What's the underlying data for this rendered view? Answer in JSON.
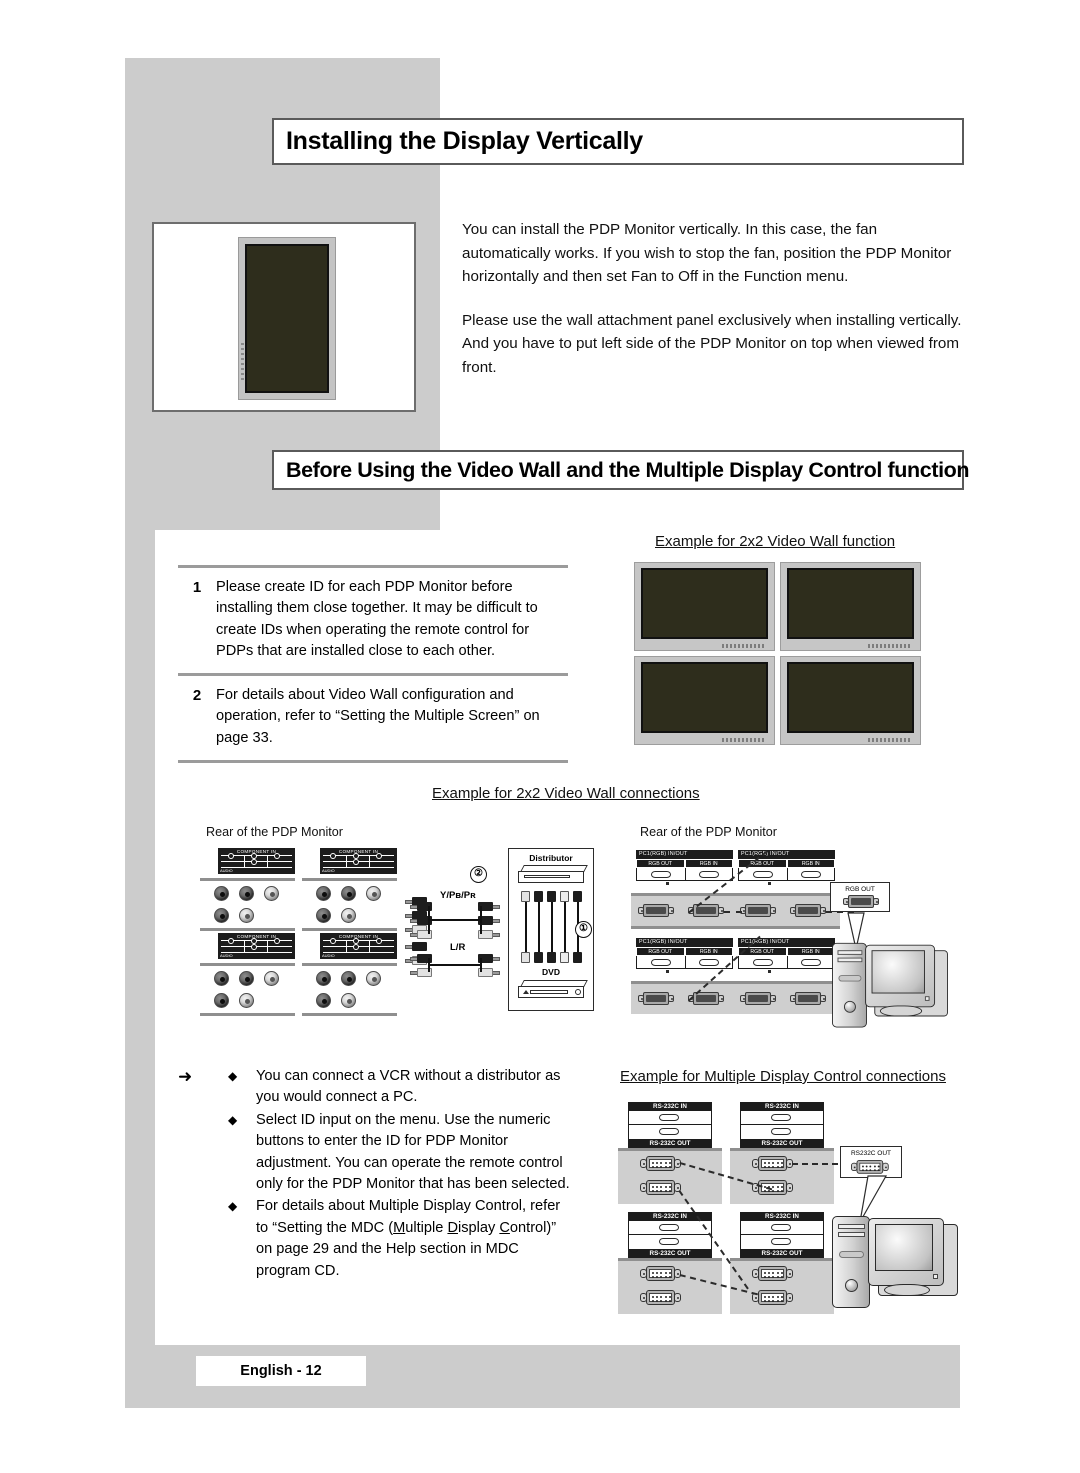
{
  "page": {
    "footer_label": "English - 12"
  },
  "headings": {
    "banner1": "Installing the Display Vertically",
    "banner2": "Before Using the Video Wall and the Multiple Display Control function"
  },
  "intro": {
    "paragraph1": "You can install the PDP Monitor vertically. In this case, the fan automatically works. If you wish to stop the fan, position the PDP Monitor horizontally and then set  Fan  to  Off  in the  Function    menu.",
    "paragraph2": "Please use the wall attachment panel exclusively when installing vertically. And you have to put left side of the PDP Monitor on top when viewed from front."
  },
  "numbered_list": [
    {
      "number": "1",
      "text": "Please create ID for each PDP Monitor before installing them close together. It may be difficult to create IDs when operating the remote control for PDPs that are installed close to each other."
    },
    {
      "number": "2",
      "text": "For details about Video Wall configuration and operation, refer to “Setting the Multiple Screen” on page 33."
    }
  ],
  "bullets": {
    "arrow_glyph": "➜",
    "bullet_glyph": "◆",
    "items": [
      {
        "text": "You can connect a VCR without a distributor as you would connect a PC."
      },
      {
        "text": "Select ID input on the menu. Use the numeric buttons to enter the ID for PDP Monitor adjustment. You can operate the remote control only for the PDP Monitor that has been selected."
      },
      {
        "text_before": "For details about Multiple Display Control, refer to “Setting the MDC (",
        "u1": "M",
        "t1": "ultiple ",
        "u2": "D",
        "t2": "isplay ",
        "u3": "C",
        "t3": "ontrol)” on page 29 and the Help section in MDC program CD."
      }
    ]
  },
  "sections": {
    "video_wall_function_title": "Example for 2x2 Video Wall function",
    "video_wall_connections_title": "Example for 2x2 Video Wall connections",
    "mdc_connections_title": "Example for Multiple Display Control connections"
  },
  "captions": {
    "rear_left": "Rear of the PDP Monitor",
    "rear_right": "Rear of the PDP Monitor"
  },
  "connection_labels": {
    "component_in": "COMPONENT IN",
    "audio": "AUDIO",
    "ypbpr": "Y/Pʙ/Pʀ",
    "lr": "L/R",
    "distributor": "Distributor",
    "dvd": "DVD",
    "marker1": "①",
    "marker2": "②",
    "pc1_rgb": "PC1(RGB) IN/OUT",
    "rgb_out": "RGB OUT",
    "rgb_in": "RGB IN",
    "callout_rgb_out": "RGB OUT",
    "rs232c_in": "RS-232C IN",
    "rs232c_out": "RS-232C OUT",
    "callout_rs232c_out": "RS232C OUT"
  },
  "colors": {
    "screen": "#2e2d1c",
    "gray_block": "#cccccc",
    "panel_gray": "#cfcfcf",
    "rule": "#9b9b9b",
    "banner_border": "#5a5a5a"
  }
}
